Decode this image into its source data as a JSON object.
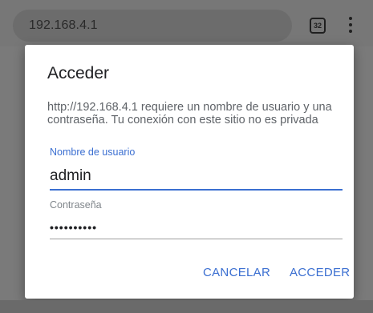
{
  "browser": {
    "url": "192.168.4.1",
    "tab_count": "32"
  },
  "dialog": {
    "title": "Acceder",
    "message": "http://192.168.4.1 requiere un nombre de usuario y una contraseña. Tu conexión con este sitio no es privada",
    "username_label": "Nombre de usuario",
    "username_value": "admin",
    "password_label": "Contraseña",
    "password_value": "••••••••••",
    "cancel_label": "CANCELAR",
    "submit_label": "ACCEDER"
  },
  "colors": {
    "accent": "#3b6fd1",
    "scrim": "#7a7a7a"
  },
  "icons": {
    "tabs": "tab-switcher-icon",
    "menu": "more-vert-icon"
  }
}
